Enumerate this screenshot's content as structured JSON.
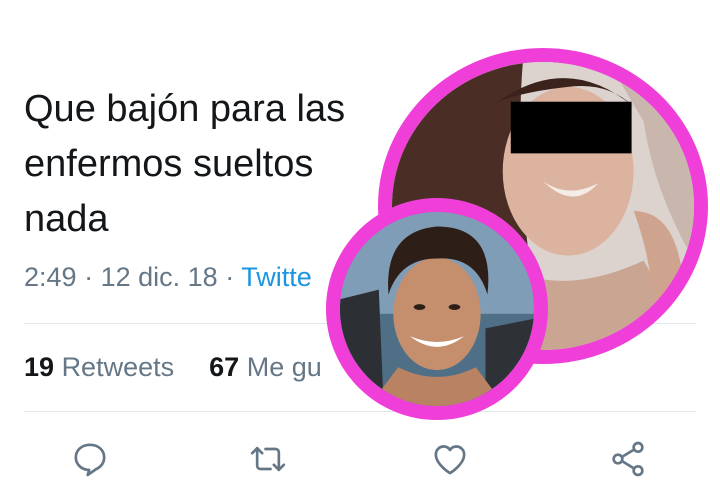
{
  "tweet": {
    "text_lines": [
      "Que bajón para las",
      "enfermos sueltos",
      "nada"
    ],
    "time": "2:49",
    "date": "12 dic. 18",
    "source": "Twitte"
  },
  "stats": {
    "retweets_count": "19",
    "retweets_label": "Retweets",
    "likes_count": "67",
    "likes_label": "Me gu"
  },
  "actions": [
    "reply-icon",
    "retweet-icon",
    "like-icon",
    "share-icon"
  ],
  "colors": {
    "text": "#14171a",
    "secondary": "#657786",
    "link": "#1b95e0",
    "circle_border": "#f03fd8",
    "divider": "#e1e8ed"
  }
}
